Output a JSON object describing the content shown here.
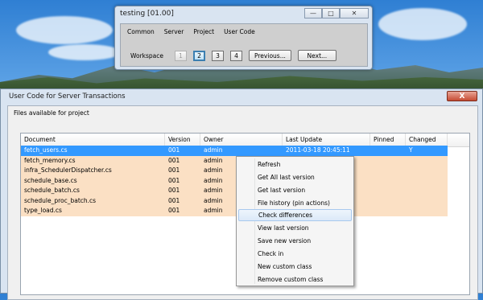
{
  "small_window": {
    "title": "testing [01.00]",
    "menu": [
      "Common",
      "Server",
      "Project",
      "User Code"
    ],
    "workspace_label": "Workspace",
    "workspace_buttons": [
      "1",
      "2",
      "3",
      "4"
    ],
    "previous_label": "Previous...",
    "next_label": "Next..."
  },
  "main_window": {
    "title": "User Code for Server Transactions",
    "close_glyph": "X",
    "files_label": "Files available for project"
  },
  "grid": {
    "columns": [
      "Document",
      "Version",
      "Owner",
      "Last Update",
      "Pinned",
      "Changed"
    ],
    "rows": [
      {
        "document": "fetch_users.cs",
        "version": "001",
        "owner": "admin",
        "last_update": "2011-03-18 20:45:11",
        "pinned": "",
        "changed": "Y"
      },
      {
        "document": "fetch_memory.cs",
        "version": "001",
        "owner": "admin",
        "last_update": "",
        "pinned": "",
        "changed": ""
      },
      {
        "document": "infra_SchedulerDispatcher.cs",
        "version": "001",
        "owner": "admin",
        "last_update": "",
        "pinned": "",
        "changed": ""
      },
      {
        "document": "schedule_base.cs",
        "version": "001",
        "owner": "admin",
        "last_update": "",
        "pinned": "",
        "changed": ""
      },
      {
        "document": "schedule_batch.cs",
        "version": "001",
        "owner": "admin",
        "last_update": "",
        "pinned": "",
        "changed": ""
      },
      {
        "document": "schedule_proc_batch.cs",
        "version": "001",
        "owner": "admin",
        "last_update": "",
        "pinned": "",
        "changed": ""
      },
      {
        "document": "type_load.cs",
        "version": "001",
        "owner": "admin",
        "last_update": "",
        "pinned": "",
        "changed": ""
      }
    ]
  },
  "context_menu": {
    "items": [
      "Refresh",
      "Get All last version",
      "Get last version",
      "File history (pin actions)",
      "Check differences",
      "View last version",
      "Save new version",
      "Check in",
      "New custom class",
      "Remove custom class"
    ],
    "hovered": "Check differences"
  },
  "colors": {
    "selected_row": "#3399ff",
    "highlight_row": "#fbe0c4",
    "title_close": "#c64c34"
  }
}
